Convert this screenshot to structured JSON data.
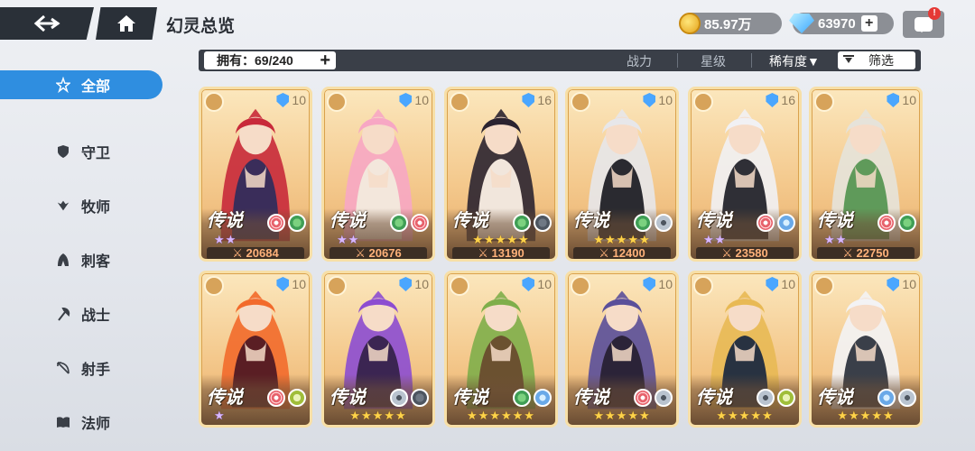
{
  "header": {
    "title": "幻灵总览",
    "gold": "85.97万",
    "gems": "63970",
    "mail_badge": "!"
  },
  "filter": {
    "owned_label": "拥有：69/240",
    "sort_power": "战力",
    "sort_star": "星级",
    "sort_rarity": "稀有度▼",
    "filter_label": "筛选"
  },
  "sidebar": {
    "items": [
      {
        "label": "全部",
        "icon": "all-star-icon",
        "active": true
      },
      {
        "label": "守卫",
        "icon": "shield-icon"
      },
      {
        "label": "牧师",
        "icon": "wings-icon"
      },
      {
        "label": "刺客",
        "icon": "hood-icon"
      },
      {
        "label": "战士",
        "icon": "axe-icon"
      },
      {
        "label": "射手",
        "icon": "bow-icon"
      },
      {
        "label": "法师",
        "icon": "book-icon"
      }
    ]
  },
  "cards": [
    {
      "level": "10",
      "rarity": "传说",
      "stars": "★★",
      "star_type": "purple",
      "power": "⚔ 20684",
      "elements": [
        "spiral",
        "leaf"
      ],
      "class_icon": "axe-icon",
      "colors": [
        "#c8293a",
        "#3a2d5a"
      ]
    },
    {
      "level": "10",
      "rarity": "传说",
      "stars": "★★",
      "star_type": "purple",
      "power": "⚔ 20676",
      "elements": [
        "leaf",
        "spiral"
      ],
      "class_icon": "wings-icon",
      "colors": [
        "#f7a7c4",
        "#f3e7dc"
      ]
    },
    {
      "level": "16",
      "rarity": "传说",
      "stars": "★★★★★",
      "star_type": "gold",
      "power": "⚔ 13190",
      "elements": [
        "leaf",
        "wind"
      ],
      "class_icon": "hood-icon",
      "colors": [
        "#2b2330",
        "#f1e6dc"
      ]
    },
    {
      "level": "10",
      "rarity": "传说",
      "stars": "★★★★★",
      "star_type": "gold",
      "power": "⚔ 12400",
      "elements": [
        "leaf",
        "eye"
      ],
      "class_icon": "bow-icon",
      "colors": [
        "#e7e7ea",
        "#2a2a30"
      ]
    },
    {
      "level": "16",
      "rarity": "传说",
      "stars": "★★",
      "star_type": "purple",
      "power": "⚔ 23580",
      "elements": [
        "spiral",
        "frost"
      ],
      "class_icon": "hood-icon",
      "colors": [
        "#f1f1f4",
        "#2f2f36"
      ]
    },
    {
      "level": "10",
      "rarity": "传说",
      "stars": "★★",
      "star_type": "purple",
      "power": "⚔ 22750",
      "elements": [
        "spiral",
        "leaf"
      ],
      "class_icon": "shield-icon",
      "colors": [
        "#e6e3da",
        "#5f9a5a"
      ]
    },
    {
      "level": "10",
      "rarity": "传说",
      "stars": "★",
      "star_type": "purple",
      "power": "",
      "elements": [
        "spiral",
        "wing"
      ],
      "class_icon": "book-icon",
      "colors": [
        "#f26a2b",
        "#5a1e24"
      ]
    },
    {
      "level": "10",
      "rarity": "传说",
      "stars": "★★★★★",
      "star_type": "gold",
      "power": "",
      "elements": [
        "eye",
        "wind"
      ],
      "class_icon": "bow-icon",
      "colors": [
        "#8c4cd1",
        "#3b2552"
      ]
    },
    {
      "level": "10",
      "rarity": "传说",
      "stars": "★★★★★★",
      "star_type": "gold",
      "power": "",
      "elements": [
        "leaf",
        "frost"
      ],
      "class_icon": "shield-icon",
      "colors": [
        "#7fae4a",
        "#6b5130"
      ]
    },
    {
      "level": "10",
      "rarity": "传说",
      "stars": "★★★★★",
      "star_type": "gold",
      "power": "",
      "elements": [
        "spiral",
        "eye"
      ],
      "class_icon": "book-icon",
      "colors": [
        "#5a4f9a",
        "#2b2338"
      ]
    },
    {
      "level": "10",
      "rarity": "传说",
      "stars": "★★★★★",
      "star_type": "gold",
      "power": "",
      "elements": [
        "eye",
        "wing"
      ],
      "class_icon": "axe-icon",
      "colors": [
        "#e8b954",
        "#283241"
      ]
    },
    {
      "level": "10",
      "rarity": "传说",
      "stars": "★★★★★",
      "star_type": "gold",
      "power": "",
      "elements": [
        "frost",
        "eye"
      ],
      "class_icon": "shield-icon",
      "colors": [
        "#f3f3f5",
        "#3a3f49"
      ]
    }
  ]
}
